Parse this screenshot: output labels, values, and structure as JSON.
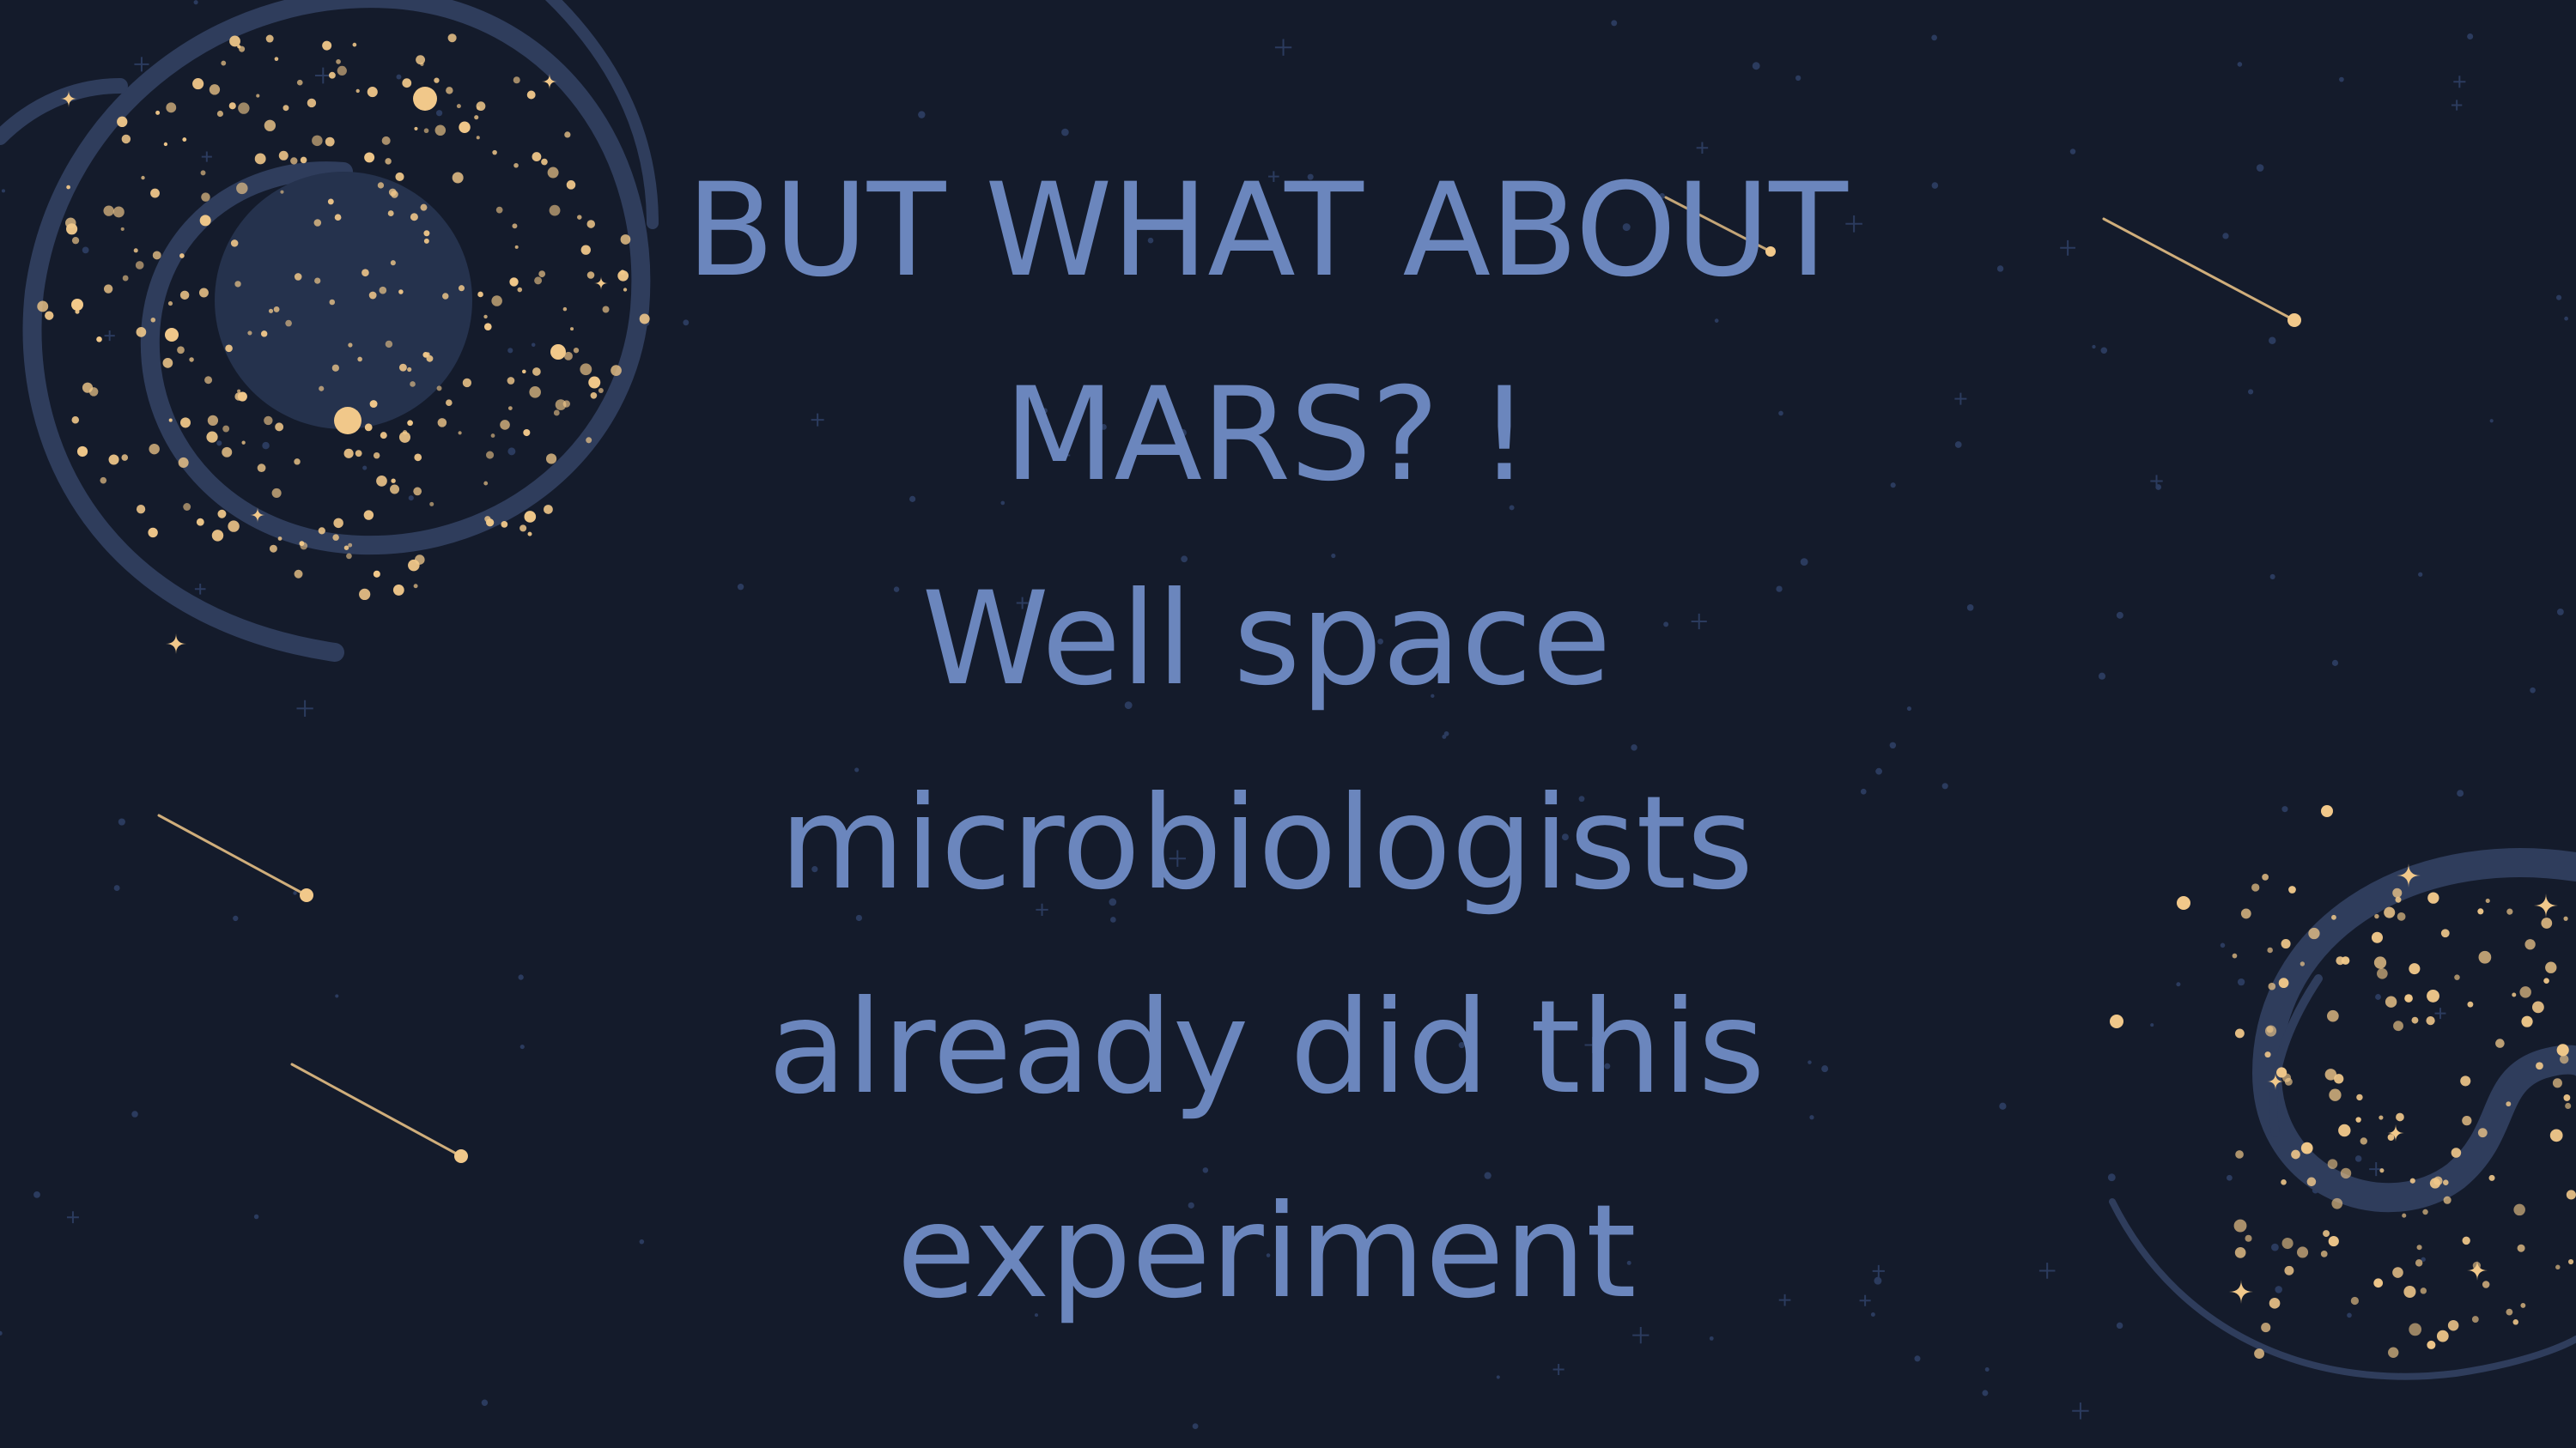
{
  "slide": {
    "lines": [
      "BUT WHAT ABOUT",
      "MARS? !",
      "Well space",
      "microbiologists",
      "already did this",
      "experiment"
    ]
  },
  "colors": {
    "background": "#141b2b",
    "text": "#6b86bd",
    "galaxy_arm": "#2f3d5c",
    "star_gold": "#f1c88a",
    "star_dim": "#2b3b5e"
  },
  "decor": {
    "elements": [
      "galaxy-top-left",
      "galaxy-bottom-right",
      "shooting-stars",
      "star-field"
    ]
  }
}
